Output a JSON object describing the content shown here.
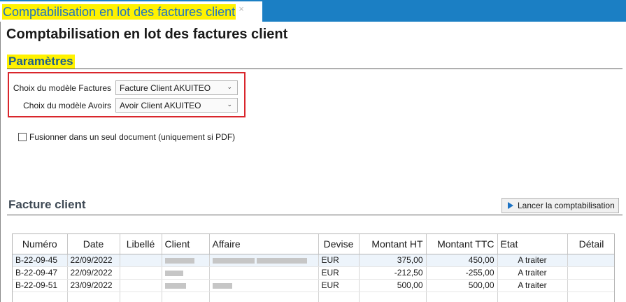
{
  "tab": {
    "title": "Comptabilisation en lot des factures client",
    "close": "×"
  },
  "page": {
    "title": "Comptabilisation en lot des factures client"
  },
  "params": {
    "heading": "Paramètres",
    "invoice_model_label": "Choix du modèle Factures",
    "invoice_model_value": "Facture Client AKUITEO",
    "credit_model_label": "Choix du modèle Avoirs",
    "credit_model_value": "Avoir Client AKUITEO",
    "merge_label": "Fusionner dans un seul document (uniquement si PDF)"
  },
  "invoices": {
    "heading": "Facture client",
    "launch_button": "Lancer la comptabilisation",
    "columns": [
      "Numéro",
      "Date",
      "Libellé",
      "Client",
      "Affaire",
      "Devise",
      "Montant HT",
      "Montant TTC",
      "Etat",
      "Détail"
    ],
    "rows": [
      {
        "numero": "B-22-09-45",
        "date": "22/09/2022",
        "libelle": "",
        "devise": "EUR",
        "ht": "375,00",
        "ttc": "450,00",
        "etat": "A traiter",
        "detail": ""
      },
      {
        "numero": "B-22-09-47",
        "date": "22/09/2022",
        "libelle": "",
        "devise": "EUR",
        "ht": "-212,50",
        "ttc": "-255,00",
        "etat": "A traiter",
        "detail": ""
      },
      {
        "numero": "B-22-09-51",
        "date": "23/09/2022",
        "libelle": "",
        "devise": "EUR",
        "ht": "500,00",
        "ttc": "500,00",
        "etat": "A traiter",
        "detail": ""
      }
    ]
  },
  "colors": {
    "accent": "#1b7fc4",
    "highlight": "#fff200",
    "frame": "#d9262c",
    "alt_row": "#edf4fb"
  },
  "icons": {
    "launch": "play-icon",
    "dropdown": "chevron-down-icon"
  }
}
